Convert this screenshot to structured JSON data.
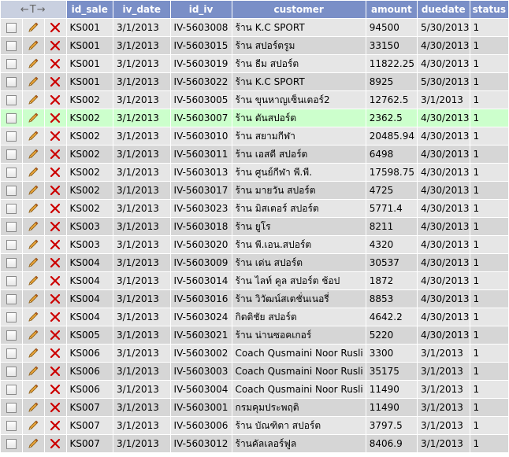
{
  "table": {
    "controls_label": "←T→",
    "columns": [
      "id_sale",
      "iv_date",
      "id_iv",
      "customer",
      "amount",
      "duedate",
      "status"
    ],
    "rows": [
      {
        "id_sale": "KS001",
        "iv_date": "3/1/2013",
        "id_iv": "IV-5603008",
        "customer": "ร้าน K.C SPORT",
        "amount": "94500",
        "duedate": "5/30/2013",
        "status": "1"
      },
      {
        "id_sale": "KS001",
        "iv_date": "3/1/2013",
        "id_iv": "IV-5603015",
        "customer": "ร้าน สปอร์ตรูม",
        "amount": "33150",
        "duedate": "4/30/2013",
        "status": "1"
      },
      {
        "id_sale": "KS001",
        "iv_date": "3/1/2013",
        "id_iv": "IV-5603019",
        "customer": "ร้าน ธีม สปอร์ต",
        "amount": "11822.25",
        "duedate": "4/30/2013",
        "status": "1"
      },
      {
        "id_sale": "KS001",
        "iv_date": "3/1/2013",
        "id_iv": "IV-5603022",
        "customer": "ร้าน K.C SPORT",
        "amount": "8925",
        "duedate": "5/30/2013",
        "status": "1"
      },
      {
        "id_sale": "KS002",
        "iv_date": "3/1/2013",
        "id_iv": "IV-5603005",
        "customer": "ร้าน ขุนหาญเซ็นเตอร์2",
        "amount": "12762.5",
        "duedate": "3/1/2013",
        "status": "1"
      },
      {
        "id_sale": "KS002",
        "iv_date": "3/1/2013",
        "id_iv": "IV-5603007",
        "customer": "ร้าน ตันสปอร์ต",
        "amount": "2362.5",
        "duedate": "4/30/2013",
        "status": "1"
      },
      {
        "id_sale": "KS002",
        "iv_date": "3/1/2013",
        "id_iv": "IV-5603010",
        "customer": "ร้าน สยามกีฬา",
        "amount": "20485.94",
        "duedate": "4/30/2013",
        "status": "1"
      },
      {
        "id_sale": "KS002",
        "iv_date": "3/1/2013",
        "id_iv": "IV-5603011",
        "customer": "ร้าน เอสดี สปอร์ต",
        "amount": "6498",
        "duedate": "4/30/2013",
        "status": "1"
      },
      {
        "id_sale": "KS002",
        "iv_date": "3/1/2013",
        "id_iv": "IV-5603013",
        "customer": "ร้าน ศูนย์กีฬา พี.พี.",
        "amount": "17598.75",
        "duedate": "4/30/2013",
        "status": "1"
      },
      {
        "id_sale": "KS002",
        "iv_date": "3/1/2013",
        "id_iv": "IV-5603017",
        "customer": "ร้าน มายวัน สปอร์ต",
        "amount": "4725",
        "duedate": "4/30/2013",
        "status": "1"
      },
      {
        "id_sale": "KS002",
        "iv_date": "3/1/2013",
        "id_iv": "IV-5603023",
        "customer": "ร้าน มิสเตอร์ สปอร์ต",
        "amount": "5771.4",
        "duedate": "4/30/2013",
        "status": "1"
      },
      {
        "id_sale": "KS003",
        "iv_date": "3/1/2013",
        "id_iv": "IV-5603018",
        "customer": "ร้าน ยูโร",
        "amount": "8211",
        "duedate": "4/30/2013",
        "status": "1"
      },
      {
        "id_sale": "KS003",
        "iv_date": "3/1/2013",
        "id_iv": "IV-5603020",
        "customer": "ร้าน พี.เอน.สปอร์ต",
        "amount": "4320",
        "duedate": "4/30/2013",
        "status": "1"
      },
      {
        "id_sale": "KS004",
        "iv_date": "3/1/2013",
        "id_iv": "IV-5603009",
        "customer": "ร้าน เด่น สปอร์ต",
        "amount": "30537",
        "duedate": "4/30/2013",
        "status": "1"
      },
      {
        "id_sale": "KS004",
        "iv_date": "3/1/2013",
        "id_iv": "IV-5603014",
        "customer": "ร้าน ไลท์ คูล สปอร์ต ช้อป",
        "amount": "1872",
        "duedate": "4/30/2013",
        "status": "1"
      },
      {
        "id_sale": "KS004",
        "iv_date": "3/1/2013",
        "id_iv": "IV-5603016",
        "customer": "ร้าน วิวัฒน์สเตชั่นเนอรี่",
        "amount": "8853",
        "duedate": "4/30/2013",
        "status": "1"
      },
      {
        "id_sale": "KS004",
        "iv_date": "3/1/2013",
        "id_iv": "IV-5603024",
        "customer": "กิตติชัย สปอร์ต",
        "amount": "4642.2",
        "duedate": "4/30/2013",
        "status": "1"
      },
      {
        "id_sale": "KS005",
        "iv_date": "3/1/2013",
        "id_iv": "IV-5603021",
        "customer": "ร้าน น่านซอคเกอร์",
        "amount": "5220",
        "duedate": "4/30/2013",
        "status": "1"
      },
      {
        "id_sale": "KS006",
        "iv_date": "3/1/2013",
        "id_iv": "IV-5603002",
        "customer": "Coach Qusmaini Noor Rusli",
        "amount": "3300",
        "duedate": "3/1/2013",
        "status": "1"
      },
      {
        "id_sale": "KS006",
        "iv_date": "3/1/2013",
        "id_iv": "IV-5603003",
        "customer": "Coach Qusmaini Noor Rusli",
        "amount": "35175",
        "duedate": "3/1/2013",
        "status": "1"
      },
      {
        "id_sale": "KS006",
        "iv_date": "3/1/2013",
        "id_iv": "IV-5603004",
        "customer": "Coach Qusmaini Noor Rusli",
        "amount": "11490",
        "duedate": "3/1/2013",
        "status": "1"
      },
      {
        "id_sale": "KS007",
        "iv_date": "3/1/2013",
        "id_iv": "IV-5603001",
        "customer": "กรมคุมประพฤติ",
        "amount": "11490",
        "duedate": "3/1/2013",
        "status": "1"
      },
      {
        "id_sale": "KS007",
        "iv_date": "3/1/2013",
        "id_iv": "IV-5603006",
        "customer": "ร้าน บัณฑิตา สปอร์ต",
        "amount": "3797.5",
        "duedate": "3/1/2013",
        "status": "1"
      },
      {
        "id_sale": "KS007",
        "iv_date": "3/1/2013",
        "id_iv": "IV-5603012",
        "customer": "ร้านคัลเลอร์ฟูล",
        "amount": "8406.9",
        "duedate": "3/1/2013",
        "status": "1"
      }
    ],
    "highlighted_row": 5
  },
  "colors": {
    "header_bg": "#7a8fc7",
    "row_odd": "#e6e6e6",
    "row_even": "#d6d6d6",
    "row_highlight": "#ccffcc",
    "delete_red": "#cc0000",
    "pencil_orange": "#e8a33a"
  },
  "icons": {
    "edit": "pencil-icon",
    "delete": "delete-x-icon",
    "select": "checkbox"
  }
}
